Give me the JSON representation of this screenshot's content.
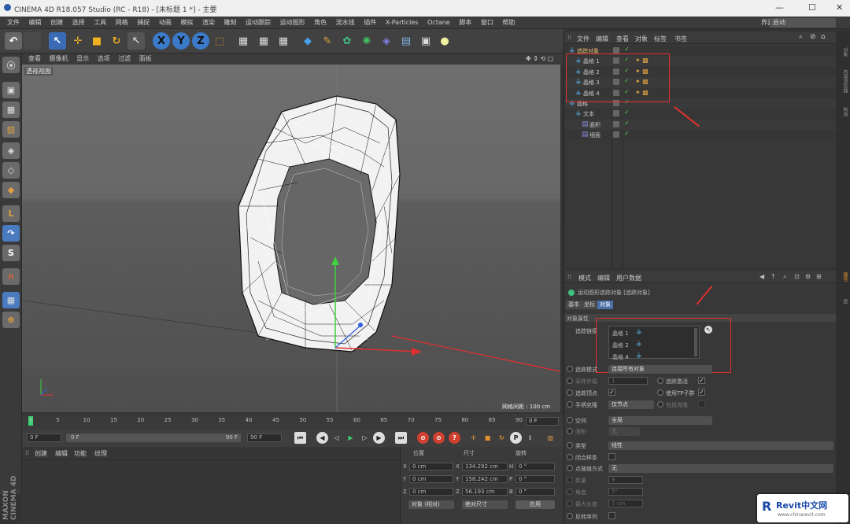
{
  "window": {
    "title": "CINEMA 4D R18.057 Studio (RC - R18) - [未标题 1 *] - 主要",
    "layout_label": "界面:",
    "layout_value": "启动"
  },
  "menu": [
    "文件",
    "编辑",
    "创建",
    "选择",
    "工具",
    "网格",
    "捕捉",
    "动画",
    "模拟",
    "渲染",
    "雕刻",
    "运动跟踪",
    "运动图形",
    "角色",
    "流水线",
    "插件",
    "X-Particles",
    "Octane",
    "脚本",
    "窗口",
    "帮助"
  ],
  "toolbar": {
    "axis_x": "X",
    "axis_y": "Y",
    "axis_z": "Z"
  },
  "viewport": {
    "menu": [
      "查看",
      "摄像机",
      "显示",
      "选项",
      "过滤",
      "面板"
    ],
    "camera_label": "透视视图",
    "grid_spacing": "网格间距 : 100 cm"
  },
  "timeline": {
    "ticks": [
      "0",
      "5",
      "10",
      "15",
      "20",
      "25",
      "30",
      "35",
      "40",
      "45",
      "50",
      "55",
      "60",
      "65",
      "70",
      "75",
      "80",
      "85",
      "90"
    ],
    "frame_end_label": "0 F"
  },
  "playback": {
    "start": "0 F",
    "slider_start": "0 F",
    "slider_end": "90 F",
    "end": "90 F"
  },
  "materials": {
    "menu": [
      "创建",
      "编辑",
      "功能",
      "纹理"
    ]
  },
  "coords": {
    "headers": [
      "位置",
      "尺寸",
      "旋转"
    ],
    "rows": [
      {
        "axis": "X",
        "pos": "0 cm",
        "size_axis": "X",
        "size": "134.292 cm",
        "rot_axis": "H",
        "rot": "0 °"
      },
      {
        "axis": "Y",
        "pos": "0 cm",
        "size_axis": "Y",
        "size": "158.242 cm",
        "rot_axis": "P",
        "rot": "0 °"
      },
      {
        "axis": "Z",
        "pos": "0 cm",
        "size_axis": "Z",
        "size": "56.193 cm",
        "rot_axis": "B",
        "rot": "0 °"
      }
    ],
    "mode": "对象 (相对)",
    "size_mode": "绝对尺寸",
    "apply": "应用"
  },
  "object_manager": {
    "menu": [
      "文件",
      "编辑",
      "查看",
      "对象",
      "标签",
      "书签"
    ],
    "objects": [
      {
        "name": "追踪对象",
        "indent": 0,
        "color": "#e8c070"
      },
      {
        "name": "晶格 1",
        "indent": 1,
        "color": "#c8c8c8"
      },
      {
        "name": "晶格 2",
        "indent": 1,
        "color": "#c8c8c8"
      },
      {
        "name": "晶格 3",
        "indent": 1,
        "color": "#c8c8c8"
      },
      {
        "name": "晶格 4",
        "indent": 1,
        "color": "#c8c8c8"
      },
      {
        "name": "晶格",
        "indent": 0,
        "color": "#c8c8c8"
      },
      {
        "name": "文本",
        "indent": 1,
        "color": "#c8c8c8"
      },
      {
        "name": "面积",
        "indent": 2,
        "color": "#c8c8c8"
      },
      {
        "name": "细面",
        "indent": 2,
        "color": "#c8c8c8"
      }
    ]
  },
  "attribute_manager": {
    "menu": [
      "模式",
      "编辑",
      "用户数据"
    ],
    "object_title": "运动图形追踪对象 [追踪对象]",
    "tabs": [
      "基本",
      "坐标",
      "对象"
    ],
    "section": "对象属性",
    "trace_link_label": "追踪链接",
    "trace_links": [
      "晶格 1",
      "晶格 2",
      "晶格 4"
    ],
    "trace_mode_label": "追踪模式",
    "trace_mode_value": "连接所有对象",
    "sample_step_label": "采样步幅",
    "sample_step_value": "1",
    "trace_active_label": "追踪激活",
    "trace_vertices_label": "追踪顶点",
    "use_tp_label": "使用TP子群",
    "handle_clone_label": "手柄克隆",
    "handle_clone_value": "仅节点",
    "include_clones_label": "包括克隆",
    "space_label": "空间",
    "space_value": "全局",
    "limit_label": "限制",
    "limit_value": "无",
    "type_label": "类型",
    "type_value": "线性",
    "close_spline_label": "闭合样条",
    "interpolation_label": "点插值方式",
    "interpolation_value": "无",
    "count_label": "数量",
    "count_value": "8",
    "angle_label": "角度",
    "angle_value": "5°",
    "max_length_label": "最大长度",
    "max_length_value": "5 cm",
    "reverse_label": "反转序列"
  },
  "right_tabs": [
    "对象",
    "内容浏览器",
    "构造",
    "属性",
    "层"
  ],
  "watermark": {
    "brand": "Revit中文网",
    "url": "www.chinarevit.com"
  }
}
